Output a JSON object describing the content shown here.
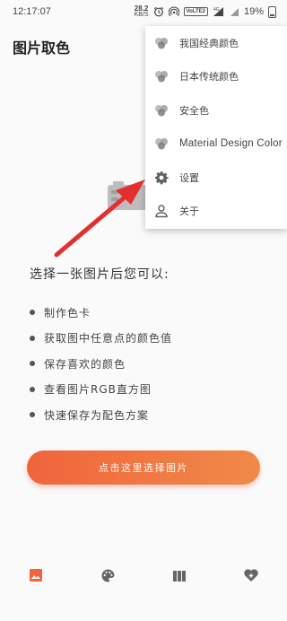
{
  "status_bar": {
    "time": "12:17:07",
    "net_speed_value": "28.2",
    "net_speed_unit": "KB/S",
    "volte_label": "VoLTE2",
    "battery": "19%"
  },
  "header": {
    "title": "图片取色"
  },
  "intro": {
    "title": "选择一张图片后您可以:",
    "features": [
      "制作色卡",
      "获取图中任意点的颜色值",
      "保存喜欢的颜色",
      "查看图片RGB直方图",
      "快速保存为配色方案"
    ]
  },
  "cta": {
    "label": "点击这里选择图片"
  },
  "menu": {
    "items": [
      {
        "label": "我国经典颜色",
        "icon": "color-circles-icon"
      },
      {
        "label": "日本传统颜色",
        "icon": "color-circles-icon"
      },
      {
        "label": "安全色",
        "icon": "color-circles-icon"
      },
      {
        "label": "Material Design Color",
        "icon": "color-circles-icon"
      },
      {
        "label": "设置",
        "icon": "gear-icon"
      },
      {
        "label": "关于",
        "icon": "person-icon"
      }
    ]
  },
  "bottom_nav": {
    "items": [
      {
        "icon": "image-icon",
        "active": true
      },
      {
        "icon": "palette-icon",
        "active": false
      },
      {
        "icon": "columns-icon",
        "active": false
      },
      {
        "icon": "heart-add-icon",
        "active": false
      }
    ]
  },
  "colors": {
    "accent": "#f0643c",
    "accent_end": "#f08a48",
    "arrow": "#e3302f",
    "nav_active": "#f0643c",
    "nav_inactive": "#666666"
  }
}
